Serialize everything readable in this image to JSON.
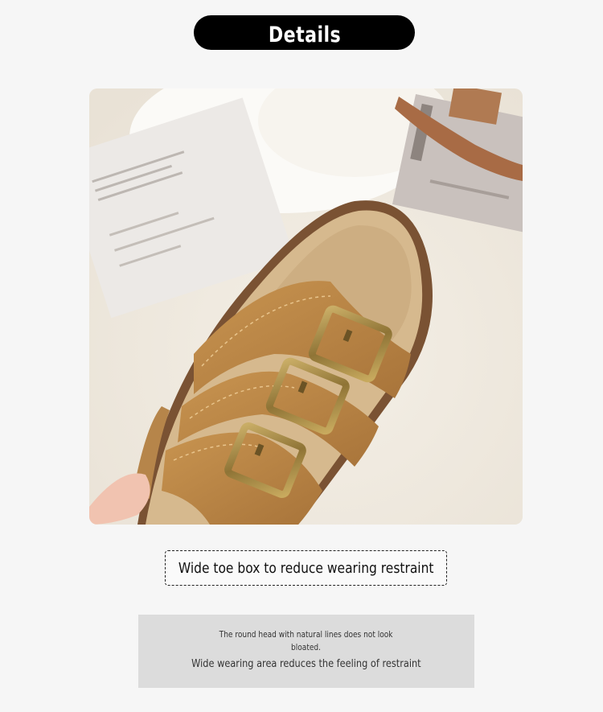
{
  "header": {
    "title": "Details"
  },
  "photo": {
    "subject": "sandal-photo",
    "colors": {
      "leather": "#b8843f",
      "buckle": "#a48a45",
      "sole": "#d6b98e",
      "background": "#f1ece3"
    }
  },
  "caption": {
    "text": "Wide toe box to reduce wearing restraint"
  },
  "description": {
    "line1": "The round head with natural lines does not look",
    "line2": "bloated.",
    "line3": "Wide wearing area reduces the feeling of restraint"
  }
}
